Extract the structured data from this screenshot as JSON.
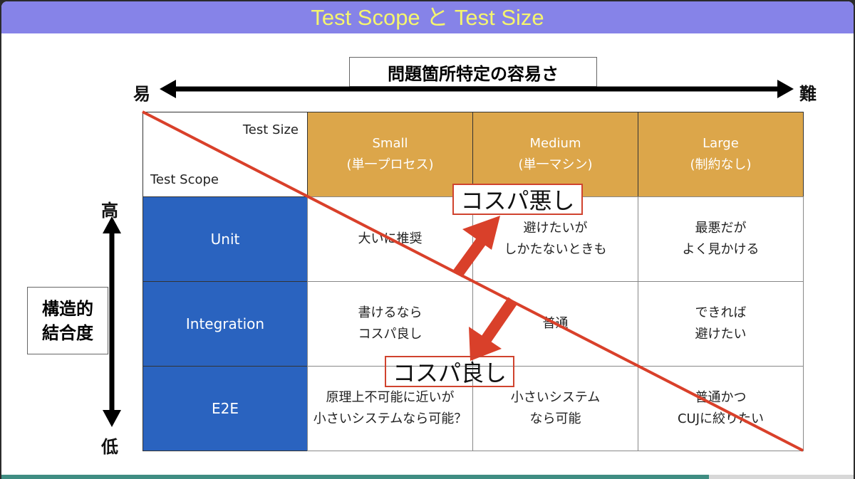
{
  "title": "Test Scope と Test Size",
  "top_axis": {
    "label": "問題箇所特定の容易さ",
    "left": "易",
    "right": "難"
  },
  "side_axis": {
    "label": "構造的\n結合度",
    "top": "高",
    "bottom": "低"
  },
  "corner": {
    "size": "Test Size",
    "scope": "Test Scope"
  },
  "columns": [
    {
      "label": "Small\n(単一プロセス)"
    },
    {
      "label": "Medium\n(単一マシン)"
    },
    {
      "label": "Large\n(制約なし)"
    }
  ],
  "rows": [
    {
      "label": "Unit",
      "cells": [
        "大いに推奨",
        "避けたいが\nしかたないときも",
        "最悪だが\nよく見かける"
      ]
    },
    {
      "label": "Integration",
      "cells": [
        "書けるなら\nコスパ良し",
        "普通",
        "できれば\n避けたい"
      ]
    },
    {
      "label": "E2E",
      "cells": [
        "原理上不可能に近いが\n小さいシステムなら可能？",
        "小さいシステム\nなら可能",
        "普通かつ\nCUJに絞りたい"
      ]
    }
  ],
  "callouts": {
    "bad": "コスパ悪し",
    "good": "コスパ良し"
  },
  "colors": {
    "title_bg": "#8683e8",
    "title_text": "#f5f56e",
    "header": "#dca64a",
    "scope": "#2a63bf",
    "accent_red": "#d9402a",
    "progress": "#3f8d82"
  },
  "progress_percent": 83
}
